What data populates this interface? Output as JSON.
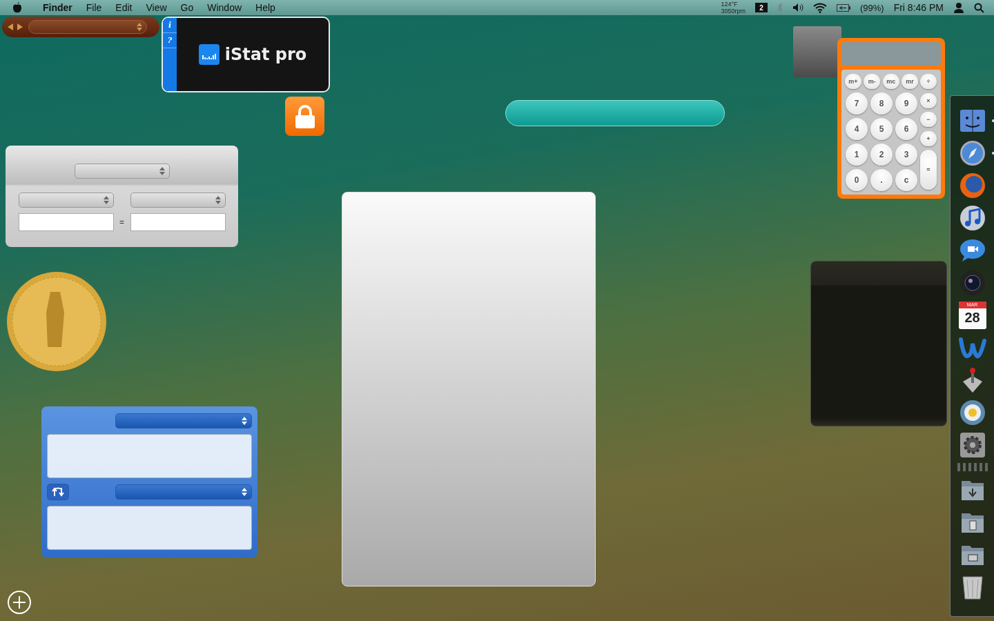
{
  "menu_bar": {
    "menus": [
      "Finder",
      "File",
      "Edit",
      "View",
      "Go",
      "Window",
      "Help"
    ],
    "status": {
      "temperature": "124°F",
      "fan_speed": "3050rpm",
      "space": "2",
      "battery": "(99%)",
      "clock": "Fri 8:46 PM"
    }
  },
  "istat": {
    "info_button": "i",
    "help_button": "?",
    "title": "iStat pro"
  },
  "calculator": {
    "memory_keys": [
      "m+",
      "m-",
      "mc",
      "mr"
    ],
    "digit_rows": [
      [
        "7",
        "8",
        "9"
      ],
      [
        "4",
        "5",
        "6"
      ],
      [
        "1",
        "2",
        "3"
      ],
      [
        "0",
        ".",
        "c"
      ]
    ],
    "operator_keys": [
      "÷",
      "×",
      "−",
      "+"
    ],
    "equals_key": "="
  },
  "unit_converter": {
    "equals": "="
  },
  "dock": [
    {
      "kind": "finder",
      "running": true
    },
    {
      "kind": "safari",
      "running": true
    },
    {
      "kind": "firefox",
      "running": false
    },
    {
      "kind": "itunes",
      "running": false
    },
    {
      "kind": "ichat",
      "running": false
    },
    {
      "kind": "lens",
      "running": false
    },
    {
      "kind": "calendar",
      "running": false,
      "month": "MAR",
      "day": "28"
    },
    {
      "kind": "wave",
      "running": false
    },
    {
      "kind": "installer",
      "running": false
    },
    {
      "kind": "dial",
      "running": false
    },
    {
      "kind": "gear",
      "running": false
    },
    {
      "kind": "separator"
    },
    {
      "kind": "stack_download"
    },
    {
      "kind": "stack_document"
    },
    {
      "kind": "stack_photo"
    },
    {
      "kind": "trash"
    }
  ]
}
